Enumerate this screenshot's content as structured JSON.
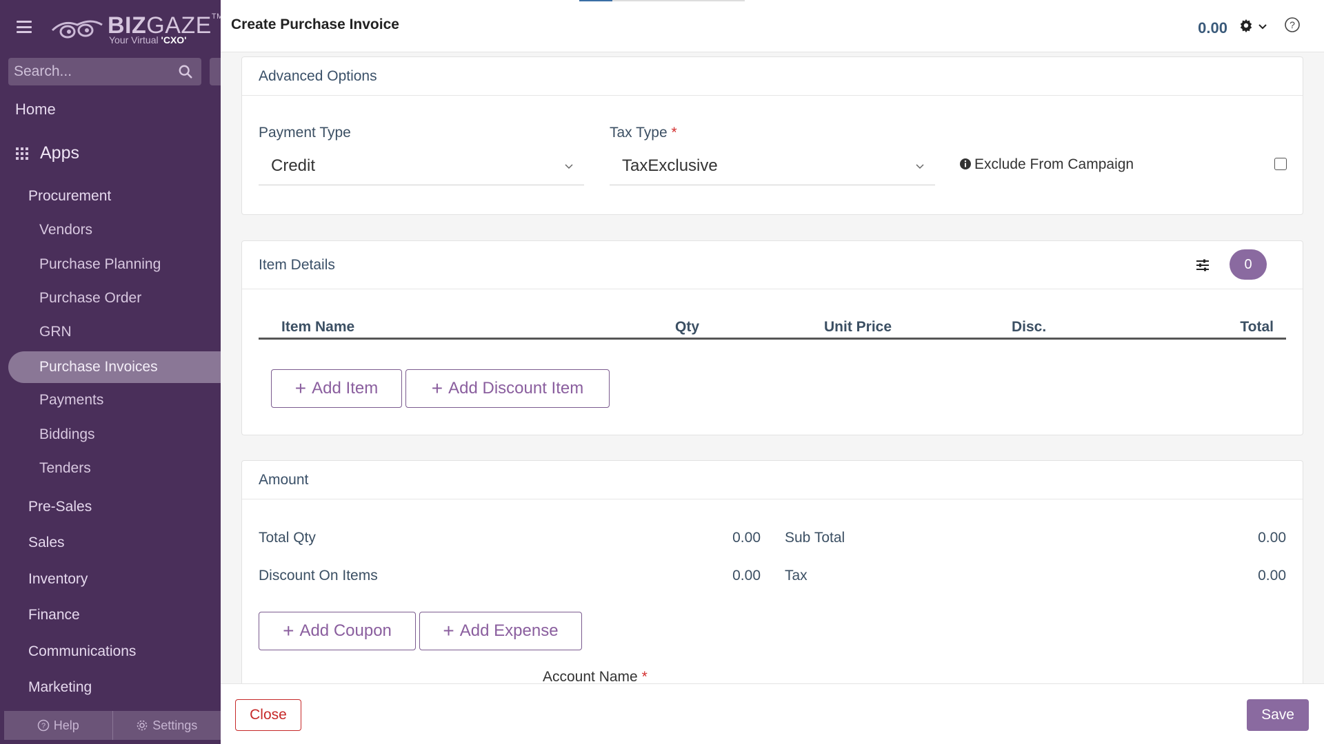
{
  "sidebar": {
    "logo": {
      "brand_bold": "BIZ",
      "brand_light": "GAZE",
      "tm": "TM",
      "tagline_prefix": "Your Virtual ",
      "tagline_bold": "'CXO'"
    },
    "search": {
      "placeholder": "Search..."
    },
    "home": "Home",
    "apps": "Apps",
    "procurement": "Procurement",
    "procurement_items": [
      "Vendors",
      "Purchase Planning",
      "Purchase Order",
      "GRN",
      "Purchase Invoices",
      "Payments",
      "Biddings",
      "Tenders"
    ],
    "active_item": "Purchase Invoices",
    "modules": [
      "Pre-Sales",
      "Sales",
      "Inventory",
      "Finance",
      "Communications",
      "Marketing"
    ],
    "footer": {
      "help": "Help",
      "settings": "Settings"
    }
  },
  "header": {
    "title": "Create Purchase Invoice",
    "amount": "0.00"
  },
  "advanced_options": {
    "title": "Advanced Options",
    "payment_type_label": "Payment Type",
    "payment_type_value": "Credit",
    "tax_type_label": "Tax Type",
    "tax_type_required": "*",
    "tax_type_value": "TaxExclusive",
    "exclude_campaign_label": "Exclude From Campaign",
    "exclude_campaign_checked": false
  },
  "item_details": {
    "title": "Item Details",
    "count": "0",
    "columns": [
      "Item Name",
      "Qty",
      "Unit Price",
      "Disc.",
      "Total"
    ],
    "add_item": "Add Item",
    "add_discount_item": "Add Discount Item"
  },
  "amount": {
    "title": "Amount",
    "total_qty_label": "Total Qty",
    "total_qty_value": "0.00",
    "sub_total_label": "Sub Total",
    "sub_total_value": "0.00",
    "discount_label": "Discount On Items",
    "discount_value": "0.00",
    "tax_label": "Tax",
    "tax_value": "0.00",
    "add_coupon": "Add Coupon",
    "add_expense": "Add Expense",
    "account_name_label": "Account Name",
    "account_name_required": "*"
  },
  "footer": {
    "close": "Close",
    "save": "Save"
  },
  "colors": {
    "sidebar_bg": "#4a2f5a",
    "accent": "#8a6aa0",
    "danger": "#c62828"
  }
}
